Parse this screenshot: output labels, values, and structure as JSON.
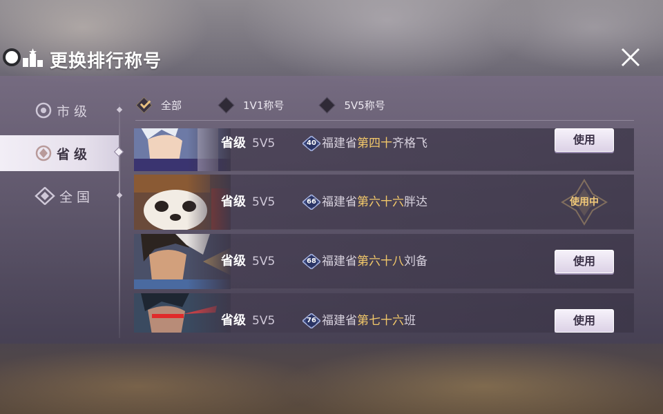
{
  "header": {
    "title": "更换排行称号"
  },
  "sidebar": {
    "items": [
      {
        "label": "市级",
        "active": false
      },
      {
        "label": "省级",
        "active": true
      },
      {
        "label": "全国",
        "active": false
      }
    ]
  },
  "filters": [
    {
      "label": "全部",
      "checked": true
    },
    {
      "label": "1V1称号",
      "checked": false
    },
    {
      "label": "5V5称号",
      "checked": false
    }
  ],
  "rows": [
    {
      "level": "省级",
      "mode": "5V5",
      "badge": "40",
      "prefix": "福建省",
      "rank": "第四十",
      "hero": "齐格飞",
      "action": "使用",
      "in_use": false
    },
    {
      "level": "省级",
      "mode": "5V5",
      "badge": "66",
      "prefix": "福建省",
      "rank": "第六十六",
      "hero": "胖达",
      "action": "使用中",
      "in_use": true
    },
    {
      "level": "省级",
      "mode": "5V5",
      "badge": "68",
      "prefix": "福建省",
      "rank": "第六十八",
      "hero": "刘备",
      "action": "使用",
      "in_use": false
    },
    {
      "level": "省级",
      "mode": "5V5",
      "badge": "76",
      "prefix": "福建省",
      "rank": "第七十六",
      "hero": "班",
      "action": "使用",
      "in_use": false
    }
  ],
  "colors": {
    "highlight": "#f2c86a",
    "in_use": "#f0c878",
    "panel": "#6a6078"
  }
}
